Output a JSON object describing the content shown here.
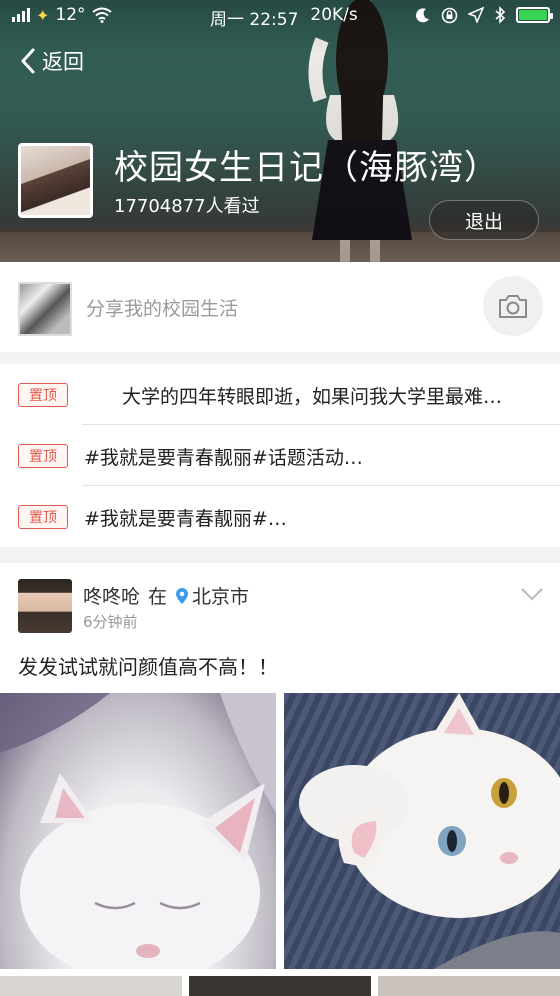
{
  "status_bar": {
    "temperature": "12°",
    "time": "周一 22:57",
    "speed": "20K/s",
    "battery_level": 1.0,
    "colors": {
      "battery": "#39d353"
    }
  },
  "header": {
    "back_label": "返回",
    "group_title": "校园女生日记（海豚湾）",
    "views": "17704877人看过",
    "exit_label": "退出"
  },
  "share": {
    "placeholder": "分享我的校园生活"
  },
  "pinned": [
    {
      "tag": "置顶",
      "text": "大学的四年转眼即逝，如果问我大学里最难…"
    },
    {
      "tag": "置顶",
      "text": "#我就是要青春靓丽#话题活动…"
    },
    {
      "tag": "置顶",
      "text": "#我就是要青春靓丽#…"
    }
  ],
  "post": {
    "author": "咚咚呛",
    "at": "在",
    "location": "北京市",
    "time": "6分钟前",
    "text": "发发试试就问颜值高不高！！",
    "colors": {
      "location_pin": "#3a9bf0"
    }
  },
  "colors": {
    "pin_tag": "#e05a4e",
    "page_bg": "#f2f2f2"
  }
}
